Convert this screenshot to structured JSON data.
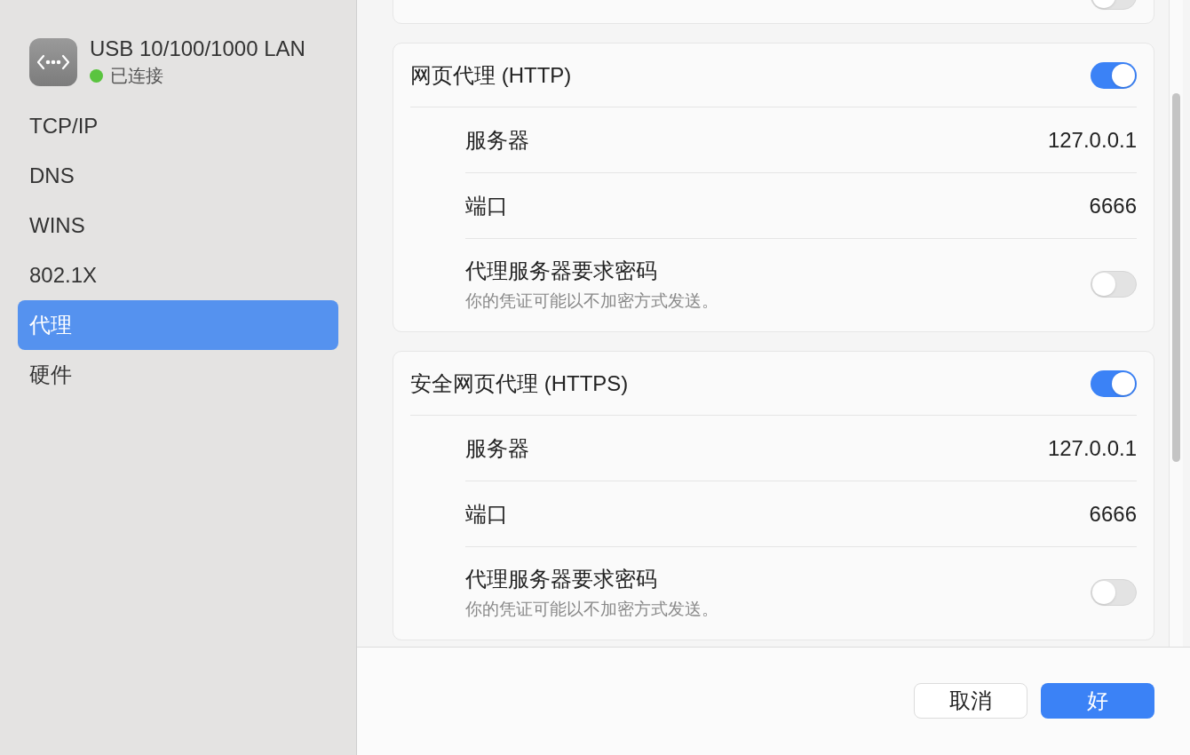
{
  "device": {
    "name": "USB 10/100/1000 LAN",
    "status": {
      "label": "已连接",
      "color": "#5ac43f"
    }
  },
  "sidebar": {
    "items": [
      {
        "label": "TCP/IP",
        "selected": false
      },
      {
        "label": "DNS",
        "selected": false
      },
      {
        "label": "WINS",
        "selected": false
      },
      {
        "label": "802.1X",
        "selected": false
      },
      {
        "label": "代理",
        "selected": true
      },
      {
        "label": "硬件",
        "selected": false
      }
    ]
  },
  "cut_section": {
    "on": false
  },
  "sections": [
    {
      "title": "网页代理 (HTTP)",
      "on": true,
      "rows": [
        {
          "kind": "value",
          "label": "服务器",
          "value": "127.0.0.1"
        },
        {
          "kind": "value",
          "label": "端口",
          "value": "6666"
        },
        {
          "kind": "toggle",
          "label": "代理服务器要求密码",
          "note": "你的凭证可能以不加密方式发送。",
          "on": false
        }
      ]
    },
    {
      "title": "安全网页代理 (HTTPS)",
      "on": true,
      "rows": [
        {
          "kind": "value",
          "label": "服务器",
          "value": "127.0.0.1"
        },
        {
          "kind": "value",
          "label": "端口",
          "value": "6666"
        },
        {
          "kind": "toggle",
          "label": "代理服务器要求密码",
          "note": "你的凭证可能以不加密方式发送。",
          "on": false
        }
      ]
    }
  ],
  "buttons": [
    {
      "label": "取消",
      "kind": "secondary"
    },
    {
      "label": "好",
      "kind": "primary"
    }
  ]
}
